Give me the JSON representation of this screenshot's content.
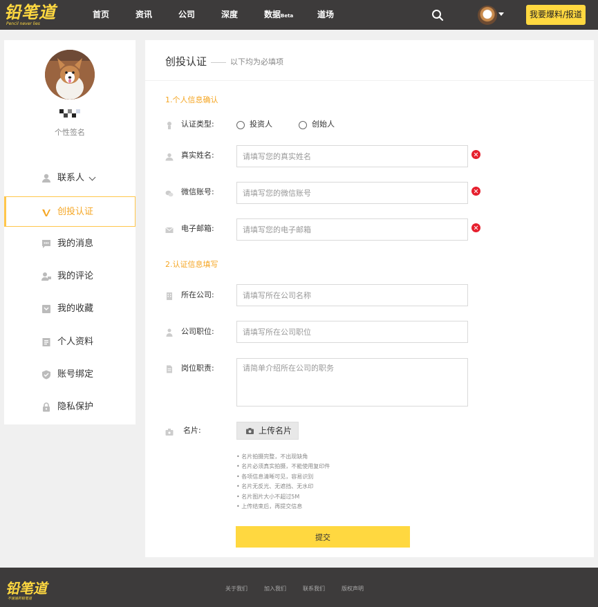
{
  "header": {
    "logo_text": "铅笔道",
    "logo_tagline": "Pencil never lies",
    "nav": [
      {
        "label": "首页"
      },
      {
        "label": "资讯"
      },
      {
        "label": "公司"
      },
      {
        "label": "深度"
      },
      {
        "label": "数据",
        "suffix": "Beta"
      },
      {
        "label": "道场"
      }
    ],
    "report_button": "我要爆料/报道"
  },
  "sidebar": {
    "signature": "个性签名",
    "items": [
      {
        "label": "联系人",
        "icon": "user-icon"
      },
      {
        "label": "创投认证",
        "icon": "v-icon",
        "active": true
      },
      {
        "label": "我的消息",
        "icon": "message-icon"
      },
      {
        "label": "我的评论",
        "icon": "comment-user-icon"
      },
      {
        "label": "我的收藏",
        "icon": "collection-icon"
      },
      {
        "label": "个人资料",
        "icon": "profile-icon"
      },
      {
        "label": "账号绑定",
        "icon": "shield-icon"
      },
      {
        "label": "隐私保护",
        "icon": "lock-icon"
      }
    ]
  },
  "main": {
    "title": "创投认证",
    "subtitle": "以下均为必填项",
    "section1": "1.个人信息确认",
    "section2": "2.认证信息填写",
    "type_label": "认证类型:",
    "type_options": [
      "投资人",
      "创始人"
    ],
    "name_label": "真实姓名:",
    "name_placeholder": "请填写您的真实姓名",
    "wechat_label": "微信账号:",
    "wechat_placeholder": "请填写您的微信账号",
    "email_label": "电子邮箱:",
    "email_placeholder": "请填写您的电子邮箱",
    "company_label": "所在公司:",
    "company_placeholder": "请填写所在公司名称",
    "position_label": "公司职位:",
    "position_placeholder": "请填写所在公司职位",
    "duty_label": "岗位职责:",
    "duty_placeholder": "请简单介绍所在公司的职务",
    "card_label": "名片:",
    "upload_label": "上传名片",
    "tips": [
      "• 名片拍摄完整，不出现缺角",
      "• 名片必须真实拍摄，不能使用复印件",
      "• 各项信息清晰可见，容易识别",
      "• 名片无反光、无遮挡、无水印",
      "• 名片图片大小不超过5M",
      "• 上传结束后，再提交信息"
    ],
    "submit_label": "提交"
  },
  "footer": {
    "logo_text": "铅笔道",
    "tagline": "不速速的铅笔道",
    "links": [
      "关于我们",
      "加入我们",
      "联系我们",
      "版权声明"
    ]
  },
  "colors": {
    "accent": "#ffd840",
    "active_text": "#f5a623",
    "error": "#e6202e",
    "topbar": "#3d3b3b"
  }
}
